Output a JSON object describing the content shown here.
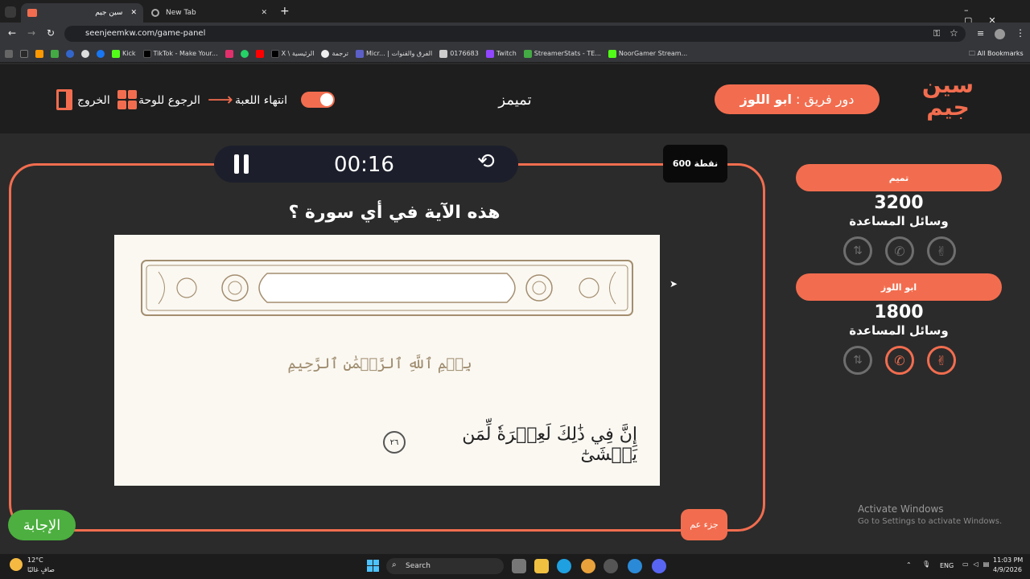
{
  "browser": {
    "tabs": [
      {
        "label": "سين جيم",
        "active": true
      },
      {
        "label": "New Tab",
        "active": false
      }
    ],
    "url": "seenjeemkw.com/game-panel",
    "bookmarks": [
      "Kick",
      "TikTok - Make Your...",
      "X \\ الرئيسية",
      "ترجمة",
      "Micr... | الفرق والقنوات",
      "0176683",
      "Twitch",
      "StreamerStats - TE...",
      "NoorGamer Stream..."
    ],
    "all_bookmarks": "All Bookmarks"
  },
  "header": {
    "turn_prefix": "دور فريق :",
    "turn_team": "ابو اللوز",
    "logo_line1": "سين",
    "logo_line2": "جيم",
    "category": "تميمز",
    "end_game": "انتهاء اللعبة",
    "back_to_board": "الرجوع للوحة",
    "exit": "الخروج"
  },
  "board": {
    "timer": "00:16",
    "points": "600 نقطة",
    "question": "هذه الآية في أي سورة ؟",
    "image_basmala": "بِسۡمِ ٱللَّهِ ٱلرَّحۡمَٰنِ ٱلرَّحِيمِ",
    "image_verse": "إِنَّ فِي ذَٰلِكَ لَعِبۡرَةٗ لِّمَن يَخۡشَىٰٓ",
    "image_verse_num": "٢٦",
    "category_tag": "جزء عم",
    "answer_button": "الإجابة"
  },
  "teams": [
    {
      "name": "تميم",
      "score": "3200",
      "aids_label": "وسائل المساعدة",
      "aids_active": [
        false,
        false,
        false
      ]
    },
    {
      "name": "ابو اللوز",
      "score": "1800",
      "aids_label": "وسائل المساعدة",
      "aids_active": [
        true,
        true,
        false
      ]
    }
  ],
  "watermark": {
    "title": "Activate Windows",
    "sub": "Go to Settings to activate Windows."
  },
  "taskbar": {
    "temp": "12°C",
    "weather": "صافٍ غالبًا",
    "search": "Search",
    "lang": "ENG",
    "time": "11:03 PM",
    "date": "4/9/2026"
  },
  "colors": {
    "accent": "#f26d4f",
    "answer_green": "#4caf3f",
    "background": "#2b2b2b"
  }
}
